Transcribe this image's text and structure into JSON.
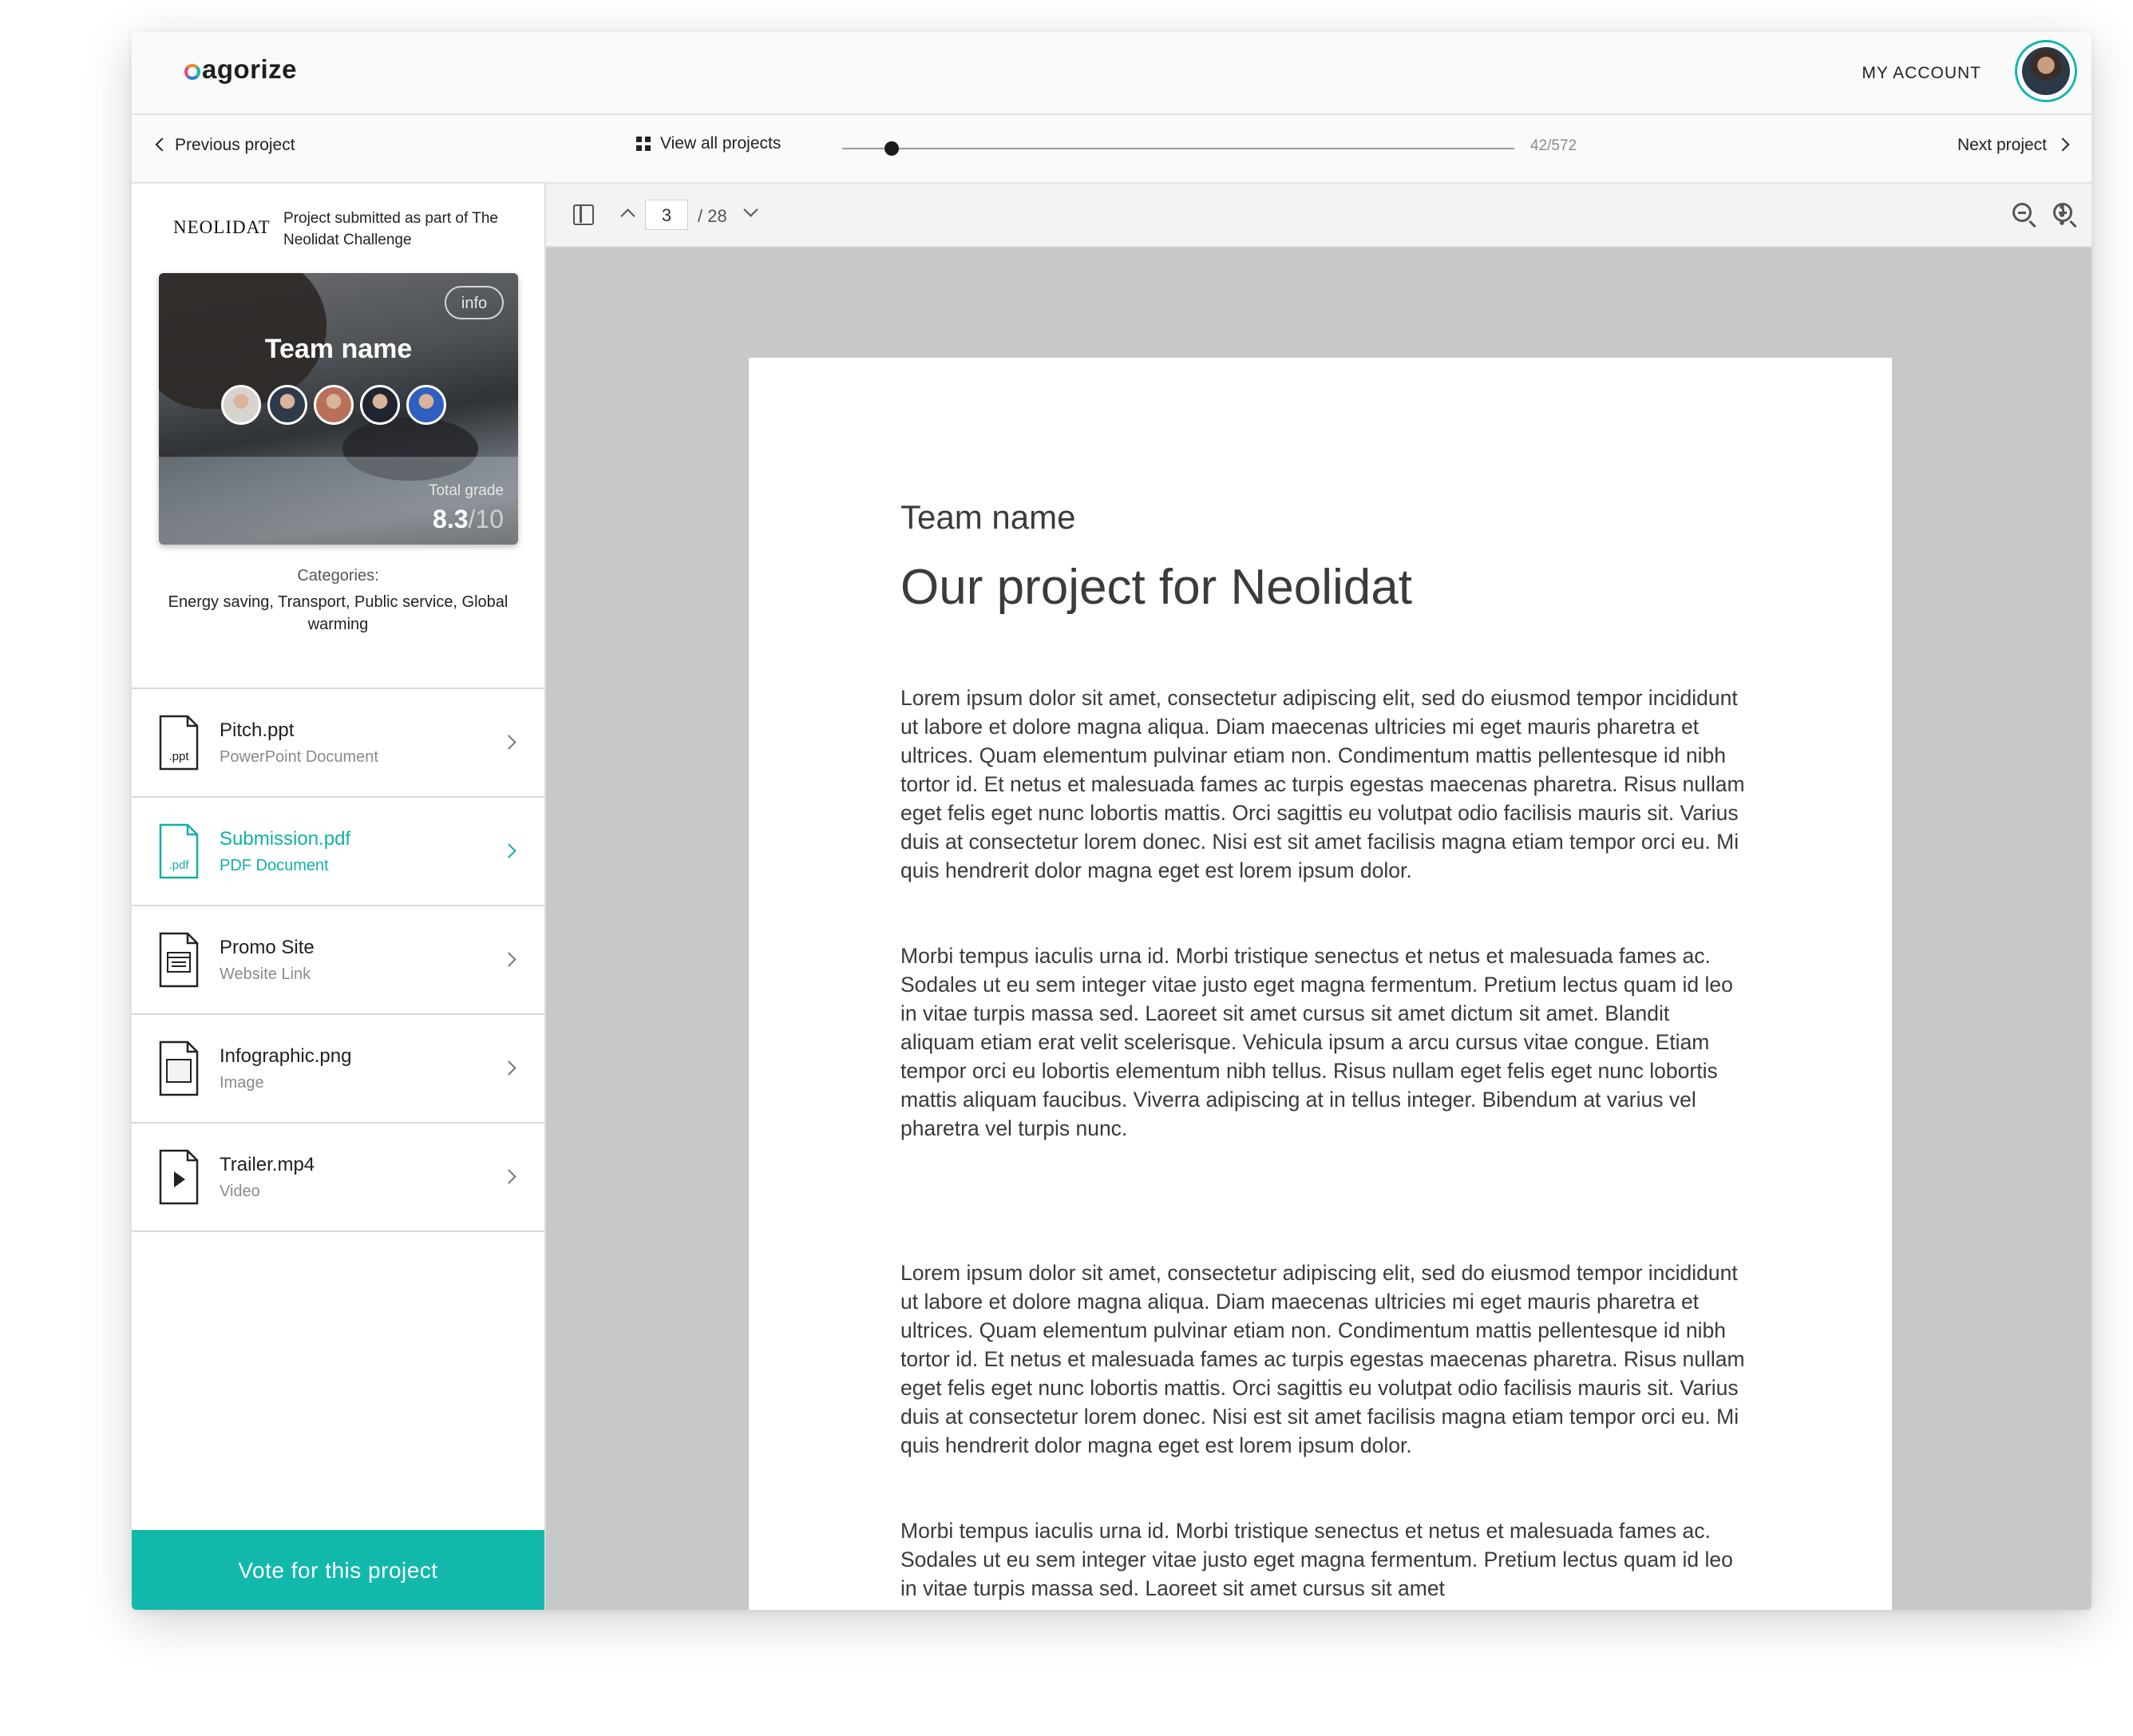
{
  "app": {
    "logo": "agorize",
    "account_label": "MY ACCOUNT"
  },
  "nav": {
    "previous_label": "Previous project",
    "view_all_label": "View all projects",
    "next_label": "Next project",
    "progress_current": 42,
    "progress_total": 572,
    "progress_text": "42/572"
  },
  "challenge": {
    "logo_text": "NEOLIDAT",
    "submitted_text": "Project submitted as part of The Neolidat Challenge"
  },
  "team_card": {
    "info_label": "info",
    "team_name": "Team name",
    "grade_label": "Total grade",
    "grade_value": "8.3",
    "grade_max": "/10",
    "member_colors": [
      "#d7d3cf",
      "#2e3a4a",
      "#b8705a",
      "#1f2430",
      "#2f5fbf"
    ]
  },
  "categories": {
    "label": "Categories:",
    "values": "Energy saving, Transport, Public service, Global warming"
  },
  "files": [
    {
      "name": "Pitch.ppt",
      "type": "PowerPoint Document",
      "icon": "ppt-file-icon",
      "ext": ".ppt",
      "active": false
    },
    {
      "name": "Submission.pdf",
      "type": "PDF Document",
      "icon": "pdf-file-icon",
      "ext": ".pdf",
      "active": true
    },
    {
      "name": "Promo Site",
      "type": "Website Link",
      "icon": "website-file-icon",
      "ext": "",
      "active": false
    },
    {
      "name": "Infographic.png",
      "type": "Image",
      "icon": "image-file-icon",
      "ext": "",
      "active": false
    },
    {
      "name": "Trailer.mp4",
      "type": "Video",
      "icon": "video-file-icon",
      "ext": "",
      "active": false
    }
  ],
  "vote_label": "Vote for this project",
  "viewer": {
    "current_page": "3",
    "total_pages": "/ 28"
  },
  "document": {
    "team": "Team name",
    "title": "Our project for Neolidat",
    "paragraphs": [
      "Lorem ipsum dolor sit amet, consectetur adipiscing elit, sed do eiusmod tempor incididunt ut labore et dolore magna aliqua. Diam maecenas ultricies mi eget mauris pharetra et ultrices. Quam elementum pulvinar etiam non. Condimentum mattis pellentesque id nibh tortor id. Et netus et malesuada fames ac turpis egestas maecenas pharetra. Risus nullam eget felis eget nunc lobortis mattis. Orci sagittis eu volutpat odio facilisis mauris sit. Varius duis at consectetur lorem donec. Nisi est sit amet facilisis magna etiam tempor orci eu. Mi quis hendrerit dolor magna eget est lorem ipsum dolor.",
      "Morbi tempus iaculis urna id. Morbi tristique senectus et netus et malesuada fames ac. Sodales ut eu sem integer vitae justo eget magna fermentum. Pretium lectus quam id leo in vitae turpis massa sed. Laoreet sit amet cursus sit amet dictum sit amet. Blandit aliquam etiam erat velit scelerisque. Vehicula ipsum a arcu cursus vitae congue. Etiam tempor orci eu lobortis elementum nibh tellus. Risus nullam eget felis eget nunc lobortis mattis aliquam faucibus. Viverra adipiscing at in tellus integer. Bibendum at varius vel pharetra vel turpis nunc.",
      "Lorem ipsum dolor sit amet, consectetur adipiscing elit, sed do eiusmod tempor incididunt ut labore et dolore magna aliqua. Diam maecenas ultricies mi eget mauris pharetra et ultrices. Quam elementum pulvinar etiam non. Condimentum mattis pellentesque id nibh tortor id. Et netus et malesuada fames ac turpis egestas maecenas pharetra. Risus nullam eget felis eget nunc lobortis mattis. Orci sagittis eu volutpat odio facilisis mauris sit. Varius duis at consectetur lorem donec. Nisi est sit amet facilisis magna etiam tempor orci eu. Mi quis hendrerit dolor magna eget est lorem ipsum dolor.",
      "Morbi tempus iaculis urna id. Morbi tristique senectus et netus et malesuada fames ac. Sodales ut eu sem integer vitae justo eget magna fermentum. Pretium lectus quam id leo in vitae turpis massa sed. Laoreet sit amet cursus sit amet"
    ]
  },
  "colors": {
    "accent": "#13b8ad",
    "viewer_bg": "#c7c8c8"
  }
}
